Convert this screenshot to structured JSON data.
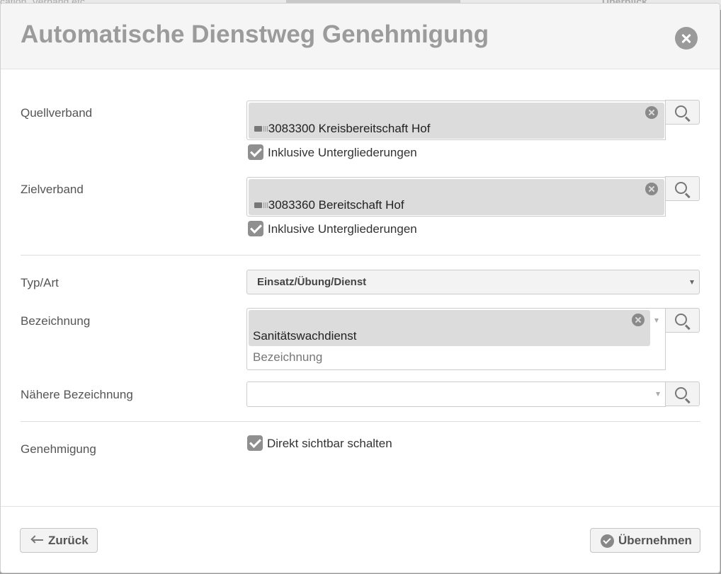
{
  "background": {
    "fragment_left": "cation, Verband etc.",
    "fragment_right": "Überblick"
  },
  "modal": {
    "title": "Automatische Dienstweg Genehmigung",
    "close_icon": "close-icon"
  },
  "form": {
    "quellverband": {
      "label": "Quellverband",
      "chip_value": "3083300 Kreisbereitschaft Hof",
      "checkbox_label": "Inklusive Untergliederungen",
      "checkbox_checked": true
    },
    "zielverband": {
      "label": "Zielverband",
      "chip_value": "3083360 Bereitschaft Hof",
      "checkbox_label": "Inklusive Untergliederungen",
      "checkbox_checked": true
    },
    "typ_art": {
      "label": "Typ/Art",
      "selected": "Einsatz/Übung/Dienst"
    },
    "bezeichnung": {
      "label": "Bezeichnung",
      "chip_value": "Sanitätswachdienst",
      "placeholder": "Bezeichnung"
    },
    "naehere_bezeichnung": {
      "label": "Nähere Bezeichnung",
      "value": ""
    },
    "genehmigung": {
      "label": "Genehmigung",
      "checkbox_label": "Direkt sichtbar schalten",
      "checkbox_checked": true
    }
  },
  "footer": {
    "back_label": "Zurück",
    "submit_label": "Übernehmen"
  },
  "colors": {
    "backdrop": "#9a9a9a",
    "header_bg": "#f5f5f5",
    "title": "#9b9b9b",
    "chip_bg": "#dcdcdc",
    "checkbox": "#8f8f8f"
  }
}
